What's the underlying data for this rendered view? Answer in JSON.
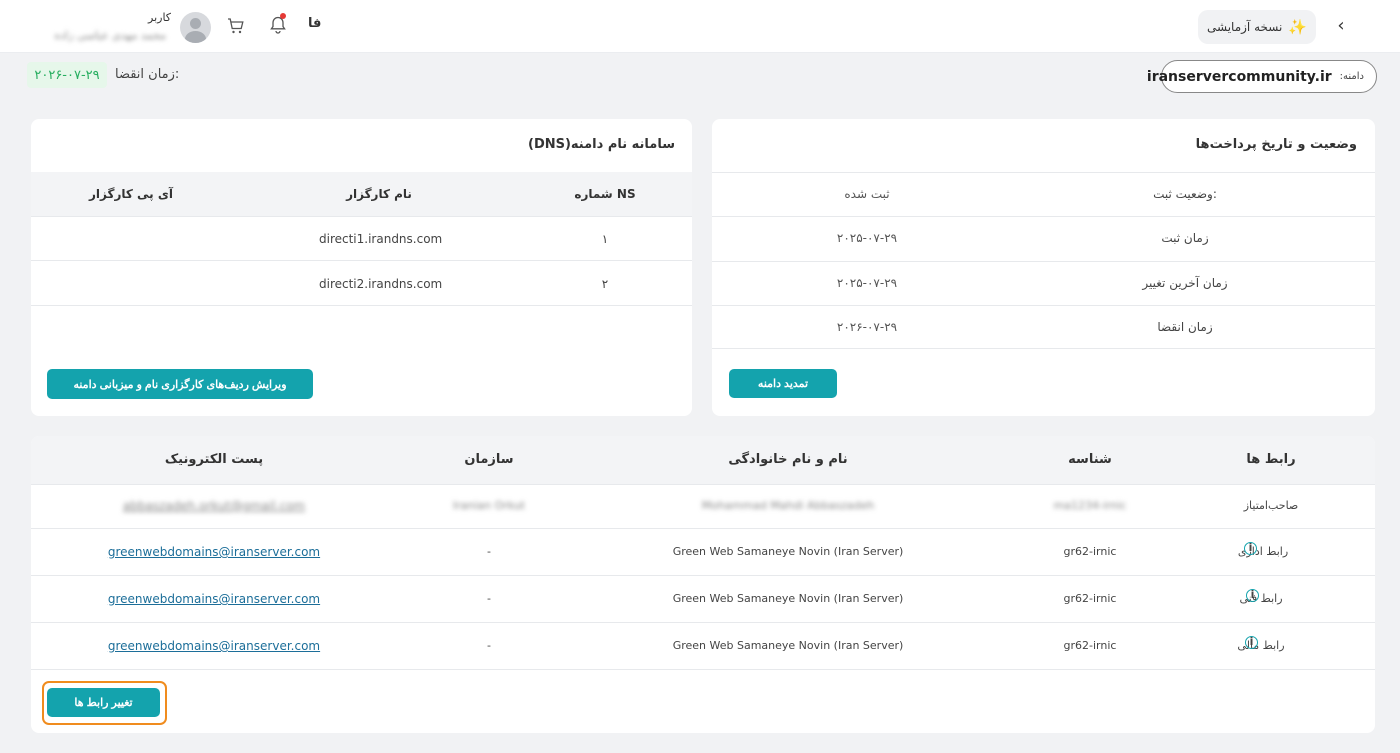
{
  "topbar": {
    "trial_label": "نسخه آزمایشی",
    "language": "فا",
    "user_role": "کاربر",
    "user_name": "محمد مهدی عباسی زاده"
  },
  "domain": {
    "label": "دامنه:",
    "name": "iranservercommunity.ir",
    "expiry_label": "زمان انقضا:",
    "expiry_date": "۲۰۲۶-۰۷-۲۹"
  },
  "payments": {
    "title": "وضعیت و تاریخ پرداخت‌ها",
    "rows": [
      {
        "key": "وضعیت ثبت:",
        "value": "ثبت شده"
      },
      {
        "key": "زمان ثبت",
        "value": "۲۰۲۵-۰۷-۲۹"
      },
      {
        "key": "زمان آخرین تغییر",
        "value": "۲۰۲۵-۰۷-۲۹"
      },
      {
        "key": "زمان انقضا",
        "value": "۲۰۲۶-۰۷-۲۹"
      }
    ],
    "renew_button": "تمدید دامنه"
  },
  "dns": {
    "title": "سامانه نام دامنه(DNS)",
    "headers": {
      "ns": "شماره NS",
      "name": "نام کارگزار",
      "ip": "آی پی کارگزار"
    },
    "rows": [
      {
        "ns": "۱",
        "name": "directi1.irandns.com",
        "ip": ""
      },
      {
        "ns": "۲",
        "name": "directi2.irandns.com",
        "ip": ""
      }
    ],
    "edit_button": "ویرایش ردیف‌های کارگزاری نام و میزبانی دامنه"
  },
  "contacts": {
    "headers": {
      "role": "رابط ها",
      "id": "شناسه",
      "name": "نام و نام خانوادگی",
      "org": "سازمان",
      "email": "پست الکترونیک"
    },
    "rows": [
      {
        "role": "صاحب‌امتیاز",
        "id": "ma1234-irnic",
        "name": "Mohammad Mahdi Abbaszadeh",
        "org": "Iranian Orkut",
        "email": "abbaszadeh.orkut@gmail.com"
      },
      {
        "role": "رابط اداری",
        "id": "gr62-irnic",
        "name": "Green Web Samaneye Novin (Iran Server)",
        "org": "-",
        "email": "greenwebdomains@iranserver.com"
      },
      {
        "role": "رابط فنی",
        "id": "gr62-irnic",
        "name": "Green Web Samaneye Novin (Iran Server)",
        "org": "-",
        "email": "greenwebdomains@iranserver.com"
      },
      {
        "role": "رابط مالی",
        "id": "gr62-irnic",
        "name": "Green Web Samaneye Novin (Iran Server)",
        "org": "-",
        "email": "greenwebdomains@iranserver.com"
      }
    ],
    "change_button": "تغییر رابط ها"
  }
}
